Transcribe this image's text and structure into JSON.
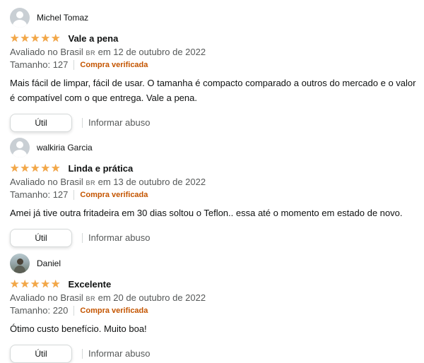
{
  "reviews": [
    {
      "name": "Michel Tomaz",
      "avatar": "default-avatar-icon",
      "rating": 5,
      "title": "Vale a pena",
      "meta_prefix": "Avaliado no Brasil",
      "flag": "BR",
      "meta_suffix": "em 12 de outubro de 2022",
      "variant": "Tamanho: 127",
      "verified": "Compra verificada",
      "body": "Mais fácil de limpar, fácil de usar. O tamanha é compacto comparado a outros do mercado e o valor é compatível com o que entrega. Vale a pena.",
      "helpful": "Útil",
      "report": "Informar abuso"
    },
    {
      "name": "walkiria Garcia",
      "avatar": "default-avatar-icon",
      "rating": 5,
      "title": "Linda e prática",
      "meta_prefix": "Avaliado no Brasil",
      "flag": "BR",
      "meta_suffix": "em 13 de outubro de 2022",
      "variant": "Tamanho: 127",
      "verified": "Compra verificada",
      "body": "Amei já tive outra fritadeira em 30 dias soltou o Teflon.. essa até o momento em estado de novo.",
      "helpful": "Útil",
      "report": "Informar abuso"
    },
    {
      "name": "Daniel",
      "avatar": "photo-avatar",
      "rating": 5,
      "title": "Excelente",
      "meta_prefix": "Avaliado no Brasil",
      "flag": "BR",
      "meta_suffix": "em 20 de outubro de 2022",
      "variant": "Tamanho: 220",
      "verified": "Compra verificada",
      "body": "Ótimo custo benefício. Muito boa!",
      "helpful": "Útil",
      "report": "Informar abuso"
    }
  ],
  "colors": {
    "star": "#f3a847",
    "verified": "#c45500",
    "meta": "#565959",
    "text": "#0f1111"
  }
}
